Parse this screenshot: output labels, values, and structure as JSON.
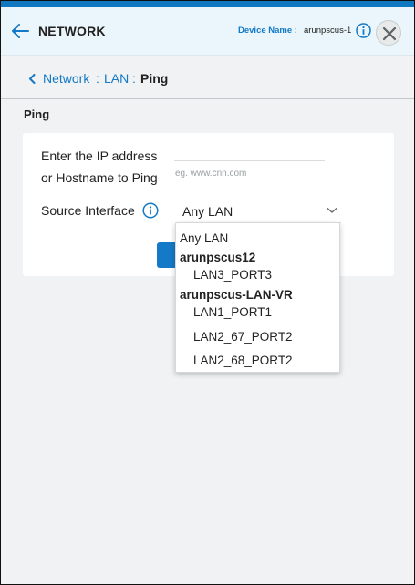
{
  "header": {
    "title": "NETWORK",
    "device_label": "Device Name :",
    "device_value": "arunpscus-1"
  },
  "breadcrumb": {
    "items": [
      "Network",
      "LAN"
    ],
    "separator": ":",
    "current": "Ping"
  },
  "section": {
    "title": "Ping"
  },
  "form": {
    "ip_label_line1": "Enter the IP address",
    "ip_label_line2": "or Hostname to Ping",
    "ip_placeholder": "eg. www.cnn.com",
    "ip_value": "",
    "source_label": "Source Interface",
    "source_selected": "Any LAN"
  },
  "dropdown": {
    "options": [
      {
        "label": "Any LAN",
        "type": "option"
      },
      {
        "label": "arunpscus12",
        "type": "group"
      },
      {
        "label": "LAN3_PORT3",
        "type": "option"
      },
      {
        "label": "arunpscus-LAN-VR",
        "type": "group"
      },
      {
        "label": "LAN1_PORT1",
        "type": "option"
      },
      {
        "label": "LAN2_67_PORT2",
        "type": "option"
      },
      {
        "label": "LAN2_68_PORT2",
        "type": "option"
      }
    ]
  },
  "icons": {
    "back": "arrow-left-icon",
    "info": "info-circle-icon",
    "close": "close-icon",
    "breadcrumb": "chevron-left-icon",
    "select": "chevron-down-icon"
  },
  "colors": {
    "accent": "#1479c6",
    "header_bg": "#eaf6fb",
    "top_bar": "#0f78c0",
    "page_bg": "#f1f2f3"
  }
}
